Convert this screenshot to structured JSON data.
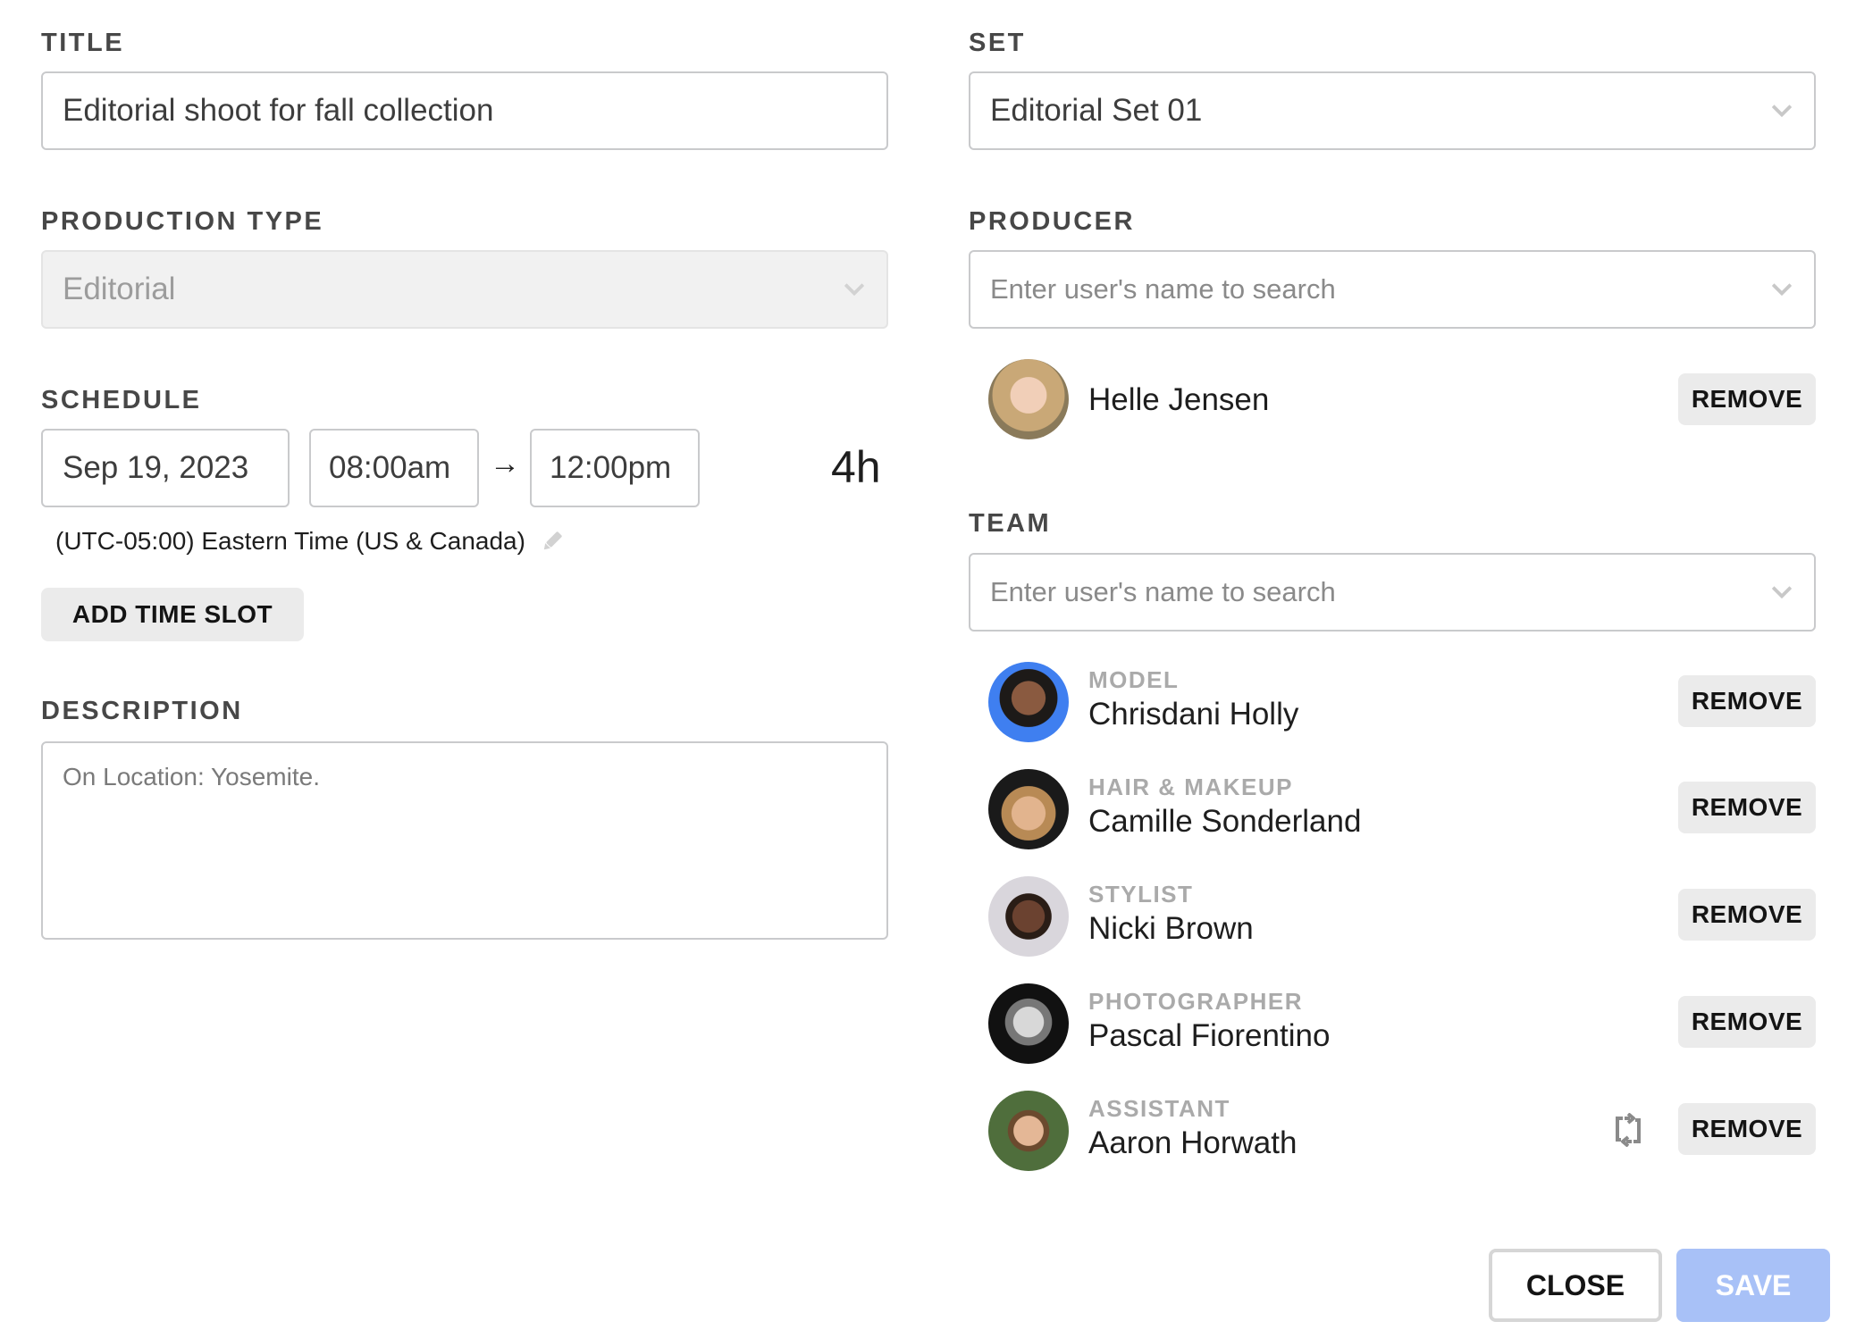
{
  "title": {
    "label": "TITLE",
    "value": "Editorial shoot for fall collection"
  },
  "production_type": {
    "label": "PRODUCTION TYPE",
    "value": "Editorial",
    "disabled": true
  },
  "schedule": {
    "label": "SCHEDULE",
    "date": "Sep 19, 2023",
    "start_time": "08:00am",
    "arrow": "→",
    "end_time": "12:00pm",
    "duration": "4h",
    "timezone": "(UTC-05:00) Eastern Time (US & Canada)",
    "add_time_slot_label": "ADD TIME SLOT"
  },
  "description": {
    "label": "DESCRIPTION",
    "value": "On Location: Yosemite."
  },
  "set": {
    "label": "SET",
    "value": "Editorial Set 01"
  },
  "producer": {
    "label": "PRODUCER",
    "placeholder": "Enter user's name to search",
    "selected": {
      "name": "Helle Jensen",
      "remove_label": "REMOVE"
    }
  },
  "team": {
    "label": "TEAM",
    "placeholder": "Enter user's name to search",
    "members": [
      {
        "role": "MODEL",
        "name": "Chrisdani Holly",
        "remove_label": "REMOVE",
        "avatar_bg": "#3f7ff0"
      },
      {
        "role": "HAIR & MAKEUP",
        "name": "Camille Sonderland",
        "remove_label": "REMOVE",
        "avatar_bg": "#1a1a1a"
      },
      {
        "role": "STYLIST",
        "name": "Nicki Brown",
        "remove_label": "REMOVE",
        "avatar_bg": "#d9d6dc"
      },
      {
        "role": "PHOTOGRAPHER",
        "name": "Pascal Fiorentino",
        "remove_label": "REMOVE",
        "avatar_bg": "#111111"
      },
      {
        "role": "ASSISTANT",
        "name": "Aaron Horwath",
        "remove_label": "REMOVE",
        "avatar_bg": "#4f6e3c",
        "has_swap_icon": true
      }
    ]
  },
  "footer": {
    "close_label": "CLOSE",
    "save_label": "SAVE"
  },
  "colors": {
    "save_disabled": "#a8c1f7",
    "label_text": "#474747",
    "role_text": "#aaaaaa",
    "button_grey": "#ebebeb"
  }
}
